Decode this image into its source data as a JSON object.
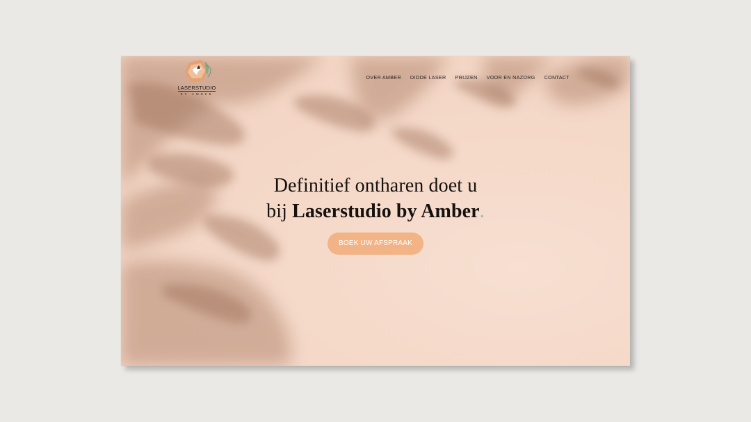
{
  "brand": {
    "name": "LASERSTUDIO",
    "sub": "BY AMBER",
    "logo_icon": "leaf-bird-badge-icon"
  },
  "nav": {
    "items": [
      {
        "label": "OVER AMBER"
      },
      {
        "label": "DIODE LASER"
      },
      {
        "label": "PRIJZEN"
      },
      {
        "label": "VOOR EN NAZORG"
      },
      {
        "label": "CONTACT"
      }
    ]
  },
  "hero": {
    "line1": "Definitief ontharen doet u",
    "line2_prefix": "bij ",
    "line2_bold": "Laserstudio by Amber",
    "line2_dot": ".",
    "cta_label": "BOEK UW AFSPRAAK"
  },
  "colors": {
    "background": "#ebe9e6",
    "hero_bg": "#f4d7c7",
    "accent": "#f2b486",
    "dot": "#9fb7a4",
    "text": "#15110f"
  }
}
